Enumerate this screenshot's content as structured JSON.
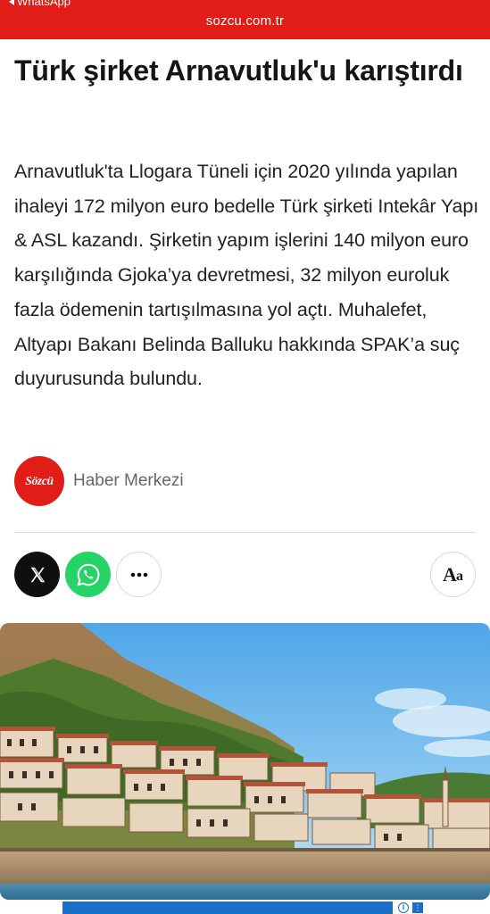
{
  "status_bar": {
    "back_label": "WhatsApp"
  },
  "address_bar": {
    "url": "sozcu.com.tr"
  },
  "article": {
    "title": "Türk şirket Arnavutluk'u karıştırdı",
    "summary": "Arnavutluk'ta Llogara Tüneli için 2020 yılında yapılan ihaleyi 172 milyon euro bedelle Türk şirketi Intekâr Yapı & ASL kazandı. Şirketin yapım işlerini 140 milyon euro karşılığında Gjoka’ya devretmesi, 32 milyon euroluk fazla ödemenin tartışılmasına yol açtı. Muhalefet, Altyapı Bakanı Belinda Balluku hakkında SPAK’a suç duyurusunda bulundu.",
    "author": {
      "logo_text": "Sözcü",
      "name": "Haber Merkezi"
    }
  },
  "share": {
    "x_icon": "x-logo-icon",
    "whatsapp_icon": "whatsapp-icon",
    "more_icon": "more-horizontal-icon",
    "font_size_label_big": "A",
    "font_size_label_small": "a"
  },
  "hero_image": {
    "description_icon": "photo"
  },
  "colors": {
    "brand_red": "#e11d17",
    "whatsapp_green": "#25d366",
    "x_black": "#0f0f0f",
    "ad_blue": "#1a6fc7"
  }
}
